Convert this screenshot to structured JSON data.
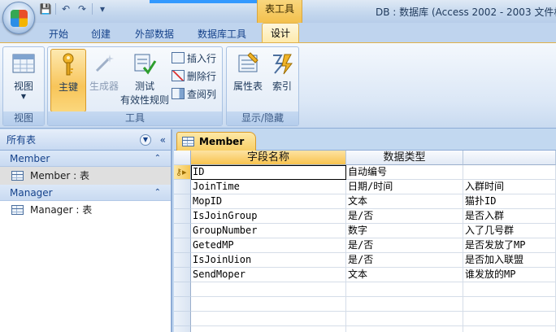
{
  "window": {
    "context_tab": "表工具",
    "title": "DB : 数据库 (Access 2002 - 2003 文件格"
  },
  "quick_access": {
    "save_icon": "💾",
    "undo_icon": "↶",
    "redo_icon": "↷",
    "customize_icon": "▾"
  },
  "ribbon_tabs": [
    "开始",
    "创建",
    "外部数据",
    "数据库工具",
    "设计"
  ],
  "groups": {
    "view": {
      "label": "视图",
      "button": "视图"
    },
    "tools": {
      "label": "工具",
      "primary_key": "主键",
      "builder": "生成器",
      "test_rules_line1": "测试",
      "test_rules_line2": "有效性规则",
      "insert_row": "插入行",
      "delete_row": "删除行",
      "lookup_column": "查阅列"
    },
    "show_hide": {
      "label": "显示/隐藏",
      "property_sheet": "属性表",
      "indexes": "索引"
    }
  },
  "nav": {
    "header": "所有表",
    "groups": [
      {
        "name": "Member",
        "item": "Member : 表"
      },
      {
        "name": "Manager",
        "item": "Manager : 表"
      }
    ]
  },
  "document": {
    "tab": "Member"
  },
  "grid": {
    "headers": [
      "字段名称",
      "数据类型",
      ""
    ],
    "rows": [
      {
        "name": "ID",
        "type": "自动编号",
        "desc": ""
      },
      {
        "name": "JoinTime",
        "type": "日期/时间",
        "desc": "入群时间"
      },
      {
        "name": "MopID",
        "type": "文本",
        "desc": "猫扑ID"
      },
      {
        "name": "IsJoinGroup",
        "type": "是/否",
        "desc": "是否入群"
      },
      {
        "name": "GroupNumber",
        "type": "数字",
        "desc": "入了几号群"
      },
      {
        "name": "GetedMP",
        "type": "是/否",
        "desc": "是否发放了MP"
      },
      {
        "name": "IsJoinUion",
        "type": "是/否",
        "desc": "是否加入联盟"
      },
      {
        "name": "SendMoper",
        "type": "文本",
        "desc": "谁发放的MP"
      }
    ]
  }
}
